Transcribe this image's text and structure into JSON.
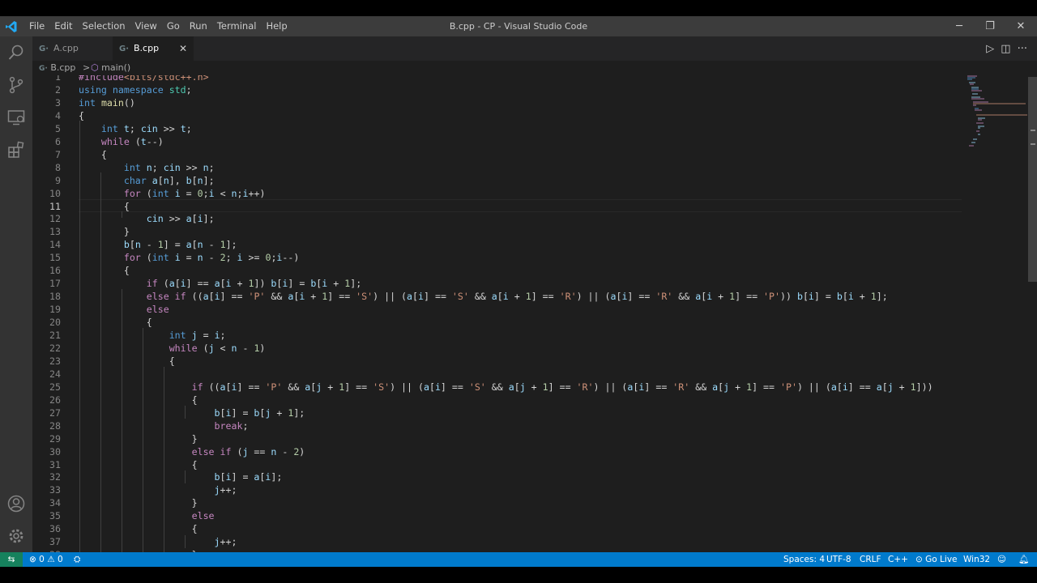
{
  "window": {
    "title": "B.cpp - CP - Visual Studio Code",
    "minimize": "─",
    "restore": "❐",
    "close": "✕"
  },
  "menu": [
    "File",
    "Edit",
    "Selection",
    "View",
    "Go",
    "Run",
    "Terminal",
    "Help"
  ],
  "tabs": [
    {
      "label": "A.cpp",
      "icon": "cpp-file-icon",
      "active": false
    },
    {
      "label": "B.cpp",
      "icon": "cpp-file-icon",
      "active": true,
      "close": "✕"
    }
  ],
  "tab_icon_glyph": "G·",
  "editor_actions": {
    "run": "▷",
    "split": "◫",
    "more": "···"
  },
  "breadcrumb": {
    "file": "B.cpp",
    "separator": ">",
    "symbol": "main()"
  },
  "code": {
    "current_line": 11,
    "lines": [
      {
        "n": "1",
        "t": "#include<bits/stdc++.h>"
      },
      {
        "n": "2",
        "t": "using namespace std;"
      },
      {
        "n": "3",
        "t": "int main()"
      },
      {
        "n": "4",
        "t": "{"
      },
      {
        "n": "5",
        "t": "    int t; cin >> t;"
      },
      {
        "n": "6",
        "t": "    while (t--)"
      },
      {
        "n": "7",
        "t": "    {"
      },
      {
        "n": "8",
        "t": "        int n; cin >> n;"
      },
      {
        "n": "9",
        "t": "        char a[n], b[n];"
      },
      {
        "n": "10",
        "t": "        for (int i = 0;i < n;i++)"
      },
      {
        "n": "11",
        "t": "        {"
      },
      {
        "n": "12",
        "t": "            cin >> a[i];"
      },
      {
        "n": "13",
        "t": "        }"
      },
      {
        "n": "14",
        "t": "        b[n - 1] = a[n - 1];"
      },
      {
        "n": "15",
        "t": "        for (int i = n - 2; i >= 0;i--)"
      },
      {
        "n": "16",
        "t": "        {"
      },
      {
        "n": "17",
        "t": "            if (a[i] == a[i + 1]) b[i] = b[i + 1];"
      },
      {
        "n": "18",
        "t": "            else if ((a[i] == 'P' && a[i + 1] == 'S') || (a[i] == 'S' && a[i + 1] == 'R') || (a[i] == 'R' && a[i + 1] == 'P')) b[i] = b[i + 1];"
      },
      {
        "n": "19",
        "t": "            else"
      },
      {
        "n": "20",
        "t": "            {"
      },
      {
        "n": "21",
        "t": "                int j = i;"
      },
      {
        "n": "22",
        "t": "                while (j < n - 1)"
      },
      {
        "n": "23",
        "t": "                {"
      },
      {
        "n": "24",
        "t": ""
      },
      {
        "n": "25",
        "t": "                    if ((a[i] == 'P' && a[j + 1] == 'S') || (a[i] == 'S' && a[j + 1] == 'R') || (a[i] == 'R' && a[j + 1] == 'P') || (a[i] == a[j + 1]))"
      },
      {
        "n": "26",
        "t": "                    {"
      },
      {
        "n": "27",
        "t": "                        b[i] = b[j + 1];"
      },
      {
        "n": "28",
        "t": "                        break;"
      },
      {
        "n": "29",
        "t": "                    }"
      },
      {
        "n": "30",
        "t": "                    else if (j == n - 2)"
      },
      {
        "n": "31",
        "t": "                    {"
      },
      {
        "n": "32",
        "t": "                        b[i] = a[i];"
      },
      {
        "n": "33",
        "t": "                        j++;"
      },
      {
        "n": "34",
        "t": "                    }"
      },
      {
        "n": "35",
        "t": "                    else"
      },
      {
        "n": "36",
        "t": "                    {"
      },
      {
        "n": "37",
        "t": "                        j++;"
      },
      {
        "n": "38",
        "t": "                    }"
      }
    ]
  },
  "status": {
    "remote": "⇆",
    "errors": "0",
    "warnings": "0",
    "spaces": "Spaces: 4",
    "encoding": "UTF-8",
    "eol": "CRLF",
    "language": "C++",
    "golive": "Go Live",
    "platform": "Win32"
  },
  "colors": {
    "keyword": "#569cd6",
    "control": "#c586c0",
    "string": "#ce9178",
    "identifier": "#9cdcfe",
    "number": "#b5cea8",
    "function": "#dcdcaa",
    "type": "#4ec9b0",
    "text": "#d4d4d4",
    "statusbar": "#007acc"
  }
}
